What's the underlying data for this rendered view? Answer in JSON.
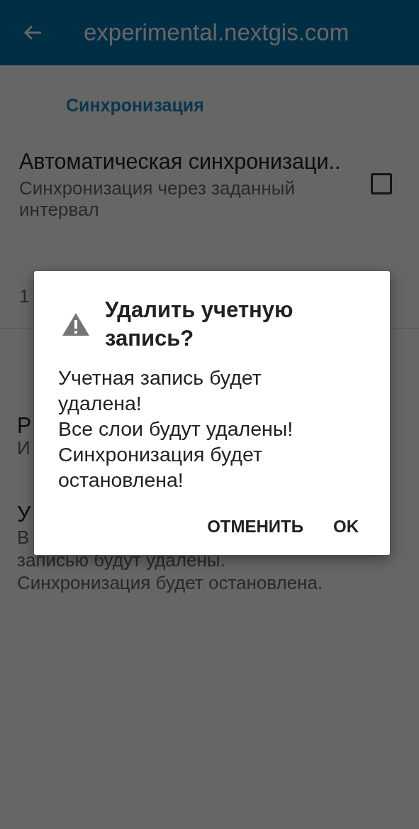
{
  "app_bar": {
    "title": "experimental.nextgis.com"
  },
  "category": "Синхронизация",
  "preferences": [
    {
      "kind": "checkbox",
      "title": "Автоматическая синхронизаци..",
      "summary": [
        "Синхронизация через заданный",
        "интервал"
      ],
      "checked": false
    },
    {
      "kind": "plain",
      "summary": [
        "1"
      ]
    },
    {
      "kind": "divider"
    },
    {
      "kind": "plain",
      "title": "Р",
      "summary": [
        "И"
      ]
    },
    {
      "kind": "plain",
      "title": "У",
      "summary": [
        "В",
        "записью будут удалены.",
        "Синхронизация будет остановлена."
      ]
    }
  ],
  "dialog": {
    "title": "Удалить учетную запись?",
    "message": [
      "Учетная запись будет удалена!",
      "Все слои будут удалены!",
      "Синхронизация будет остановлена!"
    ],
    "buttons": [
      "ОТМЕНИТЬ",
      "OK"
    ]
  }
}
